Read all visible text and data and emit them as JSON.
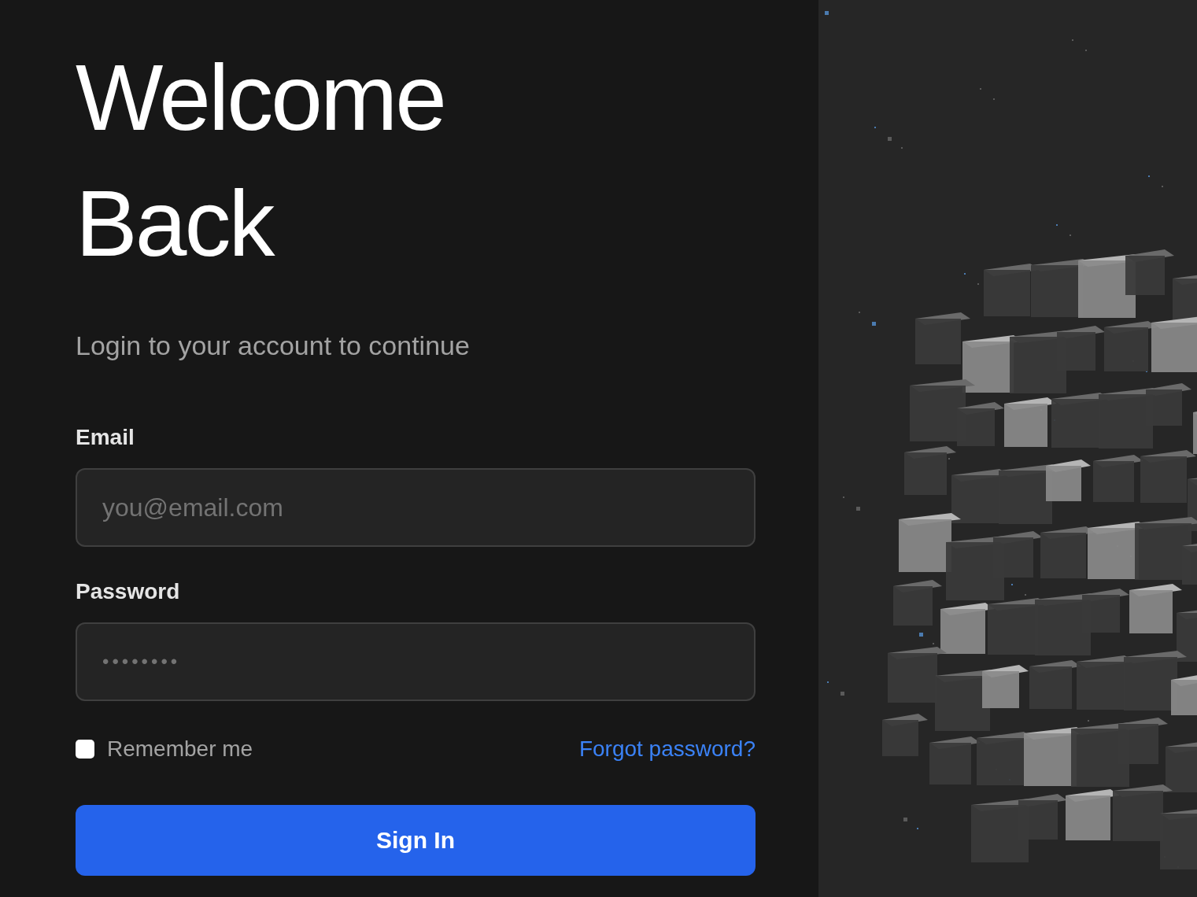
{
  "heading": {
    "lines": [
      "Welcome",
      "Back"
    ]
  },
  "subtitle": "Login to your account to continue",
  "fields": [
    {
      "label": "Email",
      "placeholder": "you@email.com",
      "kind": "text"
    },
    {
      "label": "Password",
      "placeholder": "••••••••",
      "kind": "password"
    }
  ],
  "remember": {
    "label": "Remember me",
    "checked": false
  },
  "forgot_link": "Forgot password?",
  "submit": "Sign In"
}
